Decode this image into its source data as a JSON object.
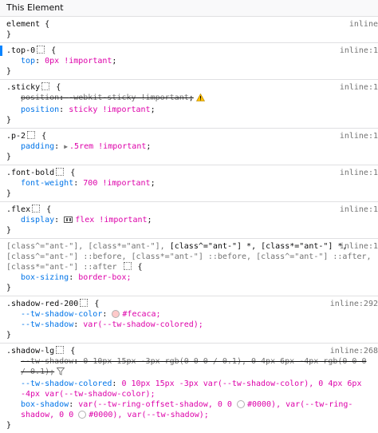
{
  "header": {
    "title": "This Element"
  },
  "rules": {
    "element": {
      "selector": "element {",
      "source": "inline",
      "close": "}"
    },
    "top0": {
      "selector": ".top-0",
      "brace": "{",
      "source": "inline:1",
      "prop": "top",
      "value": "0px !important",
      "close": "}"
    },
    "sticky": {
      "selector": ".sticky",
      "brace": "{",
      "source": "inline:1",
      "prop1": "position",
      "value1": "-webkit-sticky !important",
      "prop2": "position",
      "value2": "sticky !important",
      "close": "}"
    },
    "p2": {
      "selector": ".p-2",
      "brace": "{",
      "source": "inline:1",
      "prop": "padding",
      "value": ".5rem !important",
      "close": "}"
    },
    "fontBold": {
      "selector": ".font-bold",
      "brace": "{",
      "source": "inline:1",
      "prop": "font-weight",
      "value": "700 !important",
      "close": "}"
    },
    "flex": {
      "selector": ".flex",
      "brace": "{",
      "source": "inline:1",
      "prop": "display",
      "value": "flex !important",
      "close": "}"
    },
    "ant": {
      "sel1": "[class^=\"ant-\"], [class*=\"ant-\"],",
      "sel2": "[class^=\"ant-\"] *, [class*=\"ant-\"] *,",
      "sel3": "[class^=\"ant-\"] ::before, [class*=\"ant-\"] ::before, [class^=\"ant-\"] ::after, [class*=\"ant-\"] ::after",
      "brace": "{",
      "source": "inline:1",
      "prop": "box-sizing",
      "value": "border-box;",
      "close": "}"
    },
    "shadowRed": {
      "selector": ".shadow-red-200",
      "brace": "{",
      "source": "inline:292",
      "prop1": "--tw-shadow-color",
      "value1": "#fecaca;",
      "swatch1": "#fecaca",
      "prop2": "--tw-shadow",
      "value2": "var(--tw-shadow-colored);",
      "close": "}"
    },
    "shadowLg": {
      "selector": ".shadow-lg",
      "brace": "{",
      "source": "inline:268",
      "prop1": "--tw-shadow",
      "value1": "0 10px 15px -3px rgb(0 0 0 / 0.1), 0 4px 6px -4px rgb(0 0 0 / 0.1);",
      "prop2": "--tw-shadow-colored",
      "value2": "0 10px 15px -3px var(--tw-shadow-color), 0 4px 6px -4px var(--tw-shadow-color);",
      "prop3": "box-shadow",
      "value3a": "var(--tw-ring-offset-shadow, 0 0",
      "value3b": "#0000), var(--tw-ring-shadow, 0 0",
      "value3c": "#0000), var(--tw-shadow);",
      "close": "}"
    }
  },
  "colors": {
    "accent": "#0a84ff",
    "prop": "#0074e8",
    "value": "#dd00a9",
    "warning": "#ffbf00"
  }
}
